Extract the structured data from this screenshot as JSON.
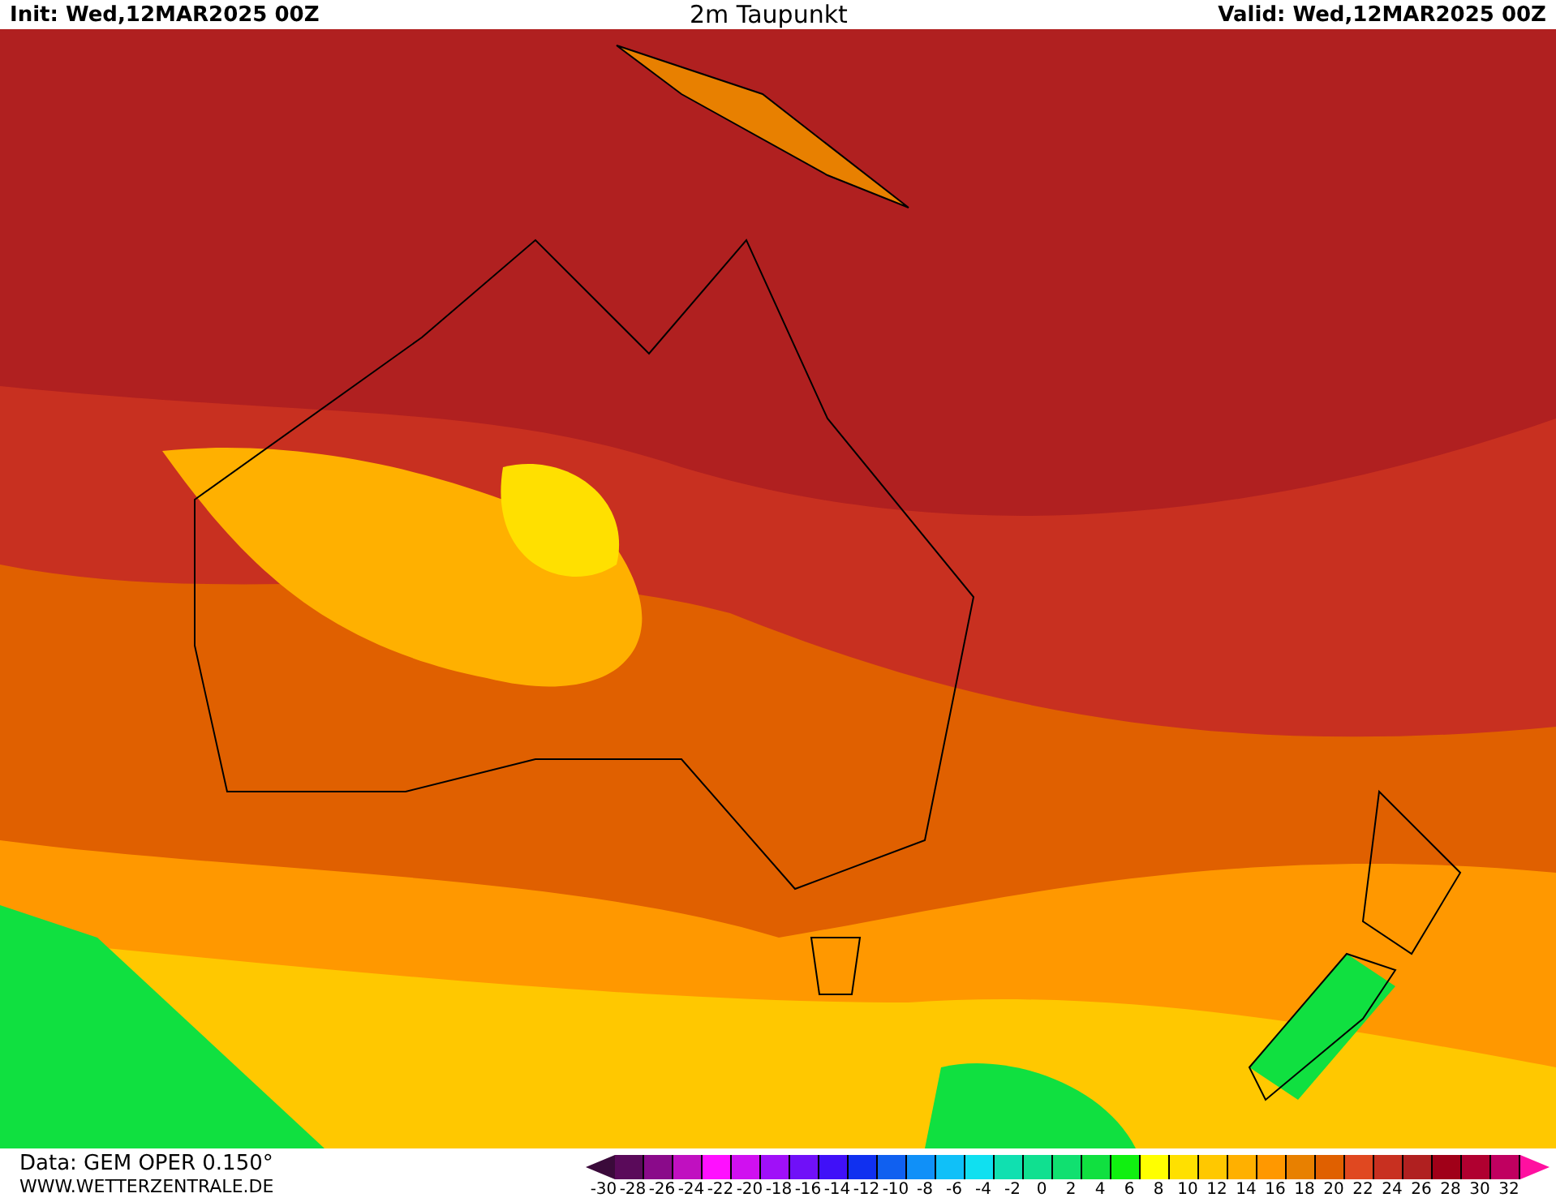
{
  "header": {
    "init": "Init: Wed,12MAR2025 00Z",
    "title": "2m Taupunkt",
    "valid": "Valid: Wed,12MAR2025 00Z"
  },
  "footer": {
    "data_source": "Data: GEM OPER 0.150°",
    "website": "WWW.WETTERZENTRALE.DE"
  },
  "legend": {
    "swatches": [
      {
        "color": "#3a0a3a"
      },
      {
        "color": "#5a0a5a"
      },
      {
        "color": "#8a0a8a"
      },
      {
        "color": "#c010c0"
      },
      {
        "color": "#ff10ff"
      },
      {
        "color": "#d010f0"
      },
      {
        "color": "#a010f8"
      },
      {
        "color": "#7010f8"
      },
      {
        "color": "#4010f8"
      },
      {
        "color": "#1030f0"
      },
      {
        "color": "#1060f0"
      },
      {
        "color": "#1090f8"
      },
      {
        "color": "#10c0f8"
      },
      {
        "color": "#10e0f0"
      },
      {
        "color": "#10e0b0"
      },
      {
        "color": "#10e090"
      },
      {
        "color": "#10e070"
      },
      {
        "color": "#10e040"
      },
      {
        "color": "#10f010"
      },
      {
        "color": "#ffff00"
      },
      {
        "color": "#ffe000"
      },
      {
        "color": "#ffc800"
      },
      {
        "color": "#ffb000"
      },
      {
        "color": "#ff9800"
      },
      {
        "color": "#e88000"
      },
      {
        "color": "#e06000"
      },
      {
        "color": "#e04820"
      },
      {
        "color": "#c83020"
      },
      {
        "color": "#b02020"
      },
      {
        "color": "#a00018"
      },
      {
        "color": "#b00030"
      },
      {
        "color": "#c00060"
      },
      {
        "color": "#ff10a0"
      }
    ],
    "ticks": [
      "-30",
      "-28",
      "-26",
      "-24",
      "-22",
      "-20",
      "-18",
      "-16",
      "-14",
      "-12",
      "-10",
      "-8",
      "-6",
      "-4",
      "-2",
      "0",
      "2",
      "4",
      "6",
      "8",
      "10",
      "12",
      "14",
      "16",
      "18",
      "20",
      "22",
      "24",
      "26",
      "28",
      "30",
      "32"
    ]
  }
}
